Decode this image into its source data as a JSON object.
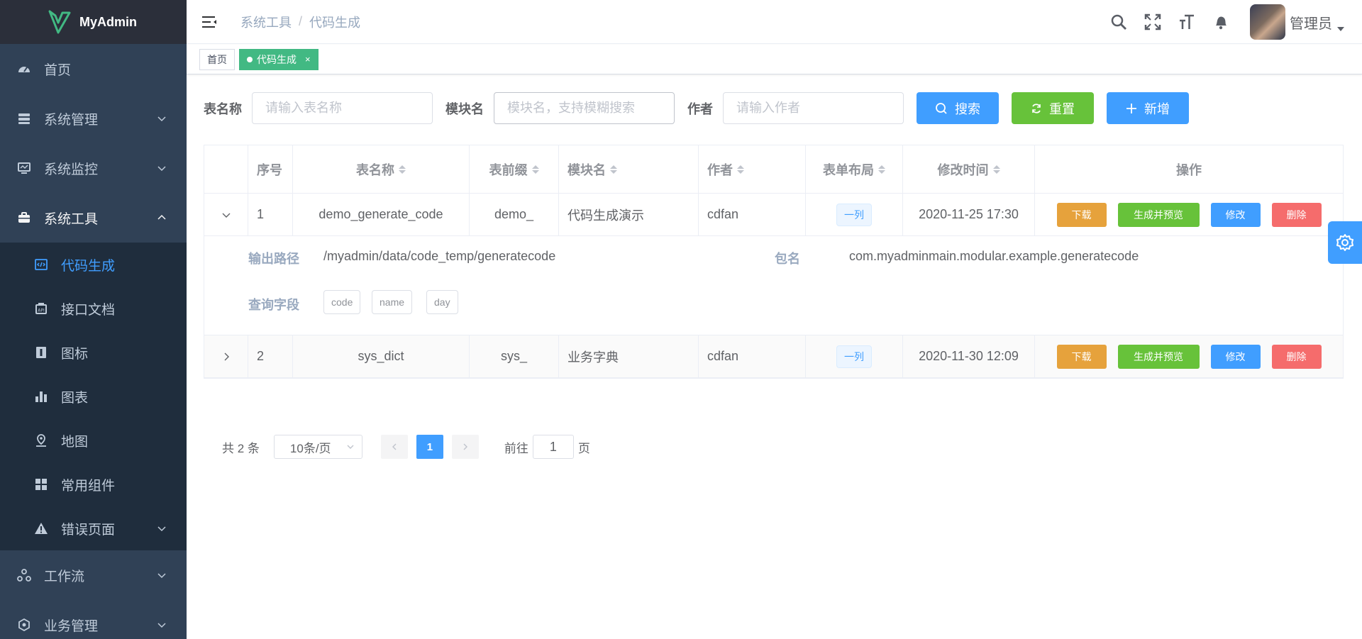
{
  "app": {
    "title": "MyAdmin"
  },
  "sidebar": {
    "items": [
      {
        "label": "首页",
        "icon": "dashboard-icon"
      },
      {
        "label": "系统管理",
        "icon": "system-icon"
      },
      {
        "label": "系统监控",
        "icon": "monitor-icon"
      },
      {
        "label": "系统工具",
        "icon": "toolbox-icon"
      },
      {
        "label": "工作流",
        "icon": "workflow-icon"
      },
      {
        "label": "业务管理",
        "icon": "business-icon"
      }
    ],
    "subitems": [
      {
        "label": "代码生成",
        "icon": "code-icon"
      },
      {
        "label": "接口文档",
        "icon": "document-icon"
      },
      {
        "label": "图标",
        "icon": "icon-icon"
      },
      {
        "label": "图表",
        "icon": "chart-icon"
      },
      {
        "label": "地图",
        "icon": "map-icon"
      },
      {
        "label": "常用组件",
        "icon": "component-icon"
      },
      {
        "label": "错误页面",
        "icon": "warning-icon"
      }
    ]
  },
  "navbar": {
    "breadcrumb": [
      "系统工具",
      "代码生成"
    ],
    "breadcrumb_sep": "/",
    "username": "管理员"
  },
  "tags": {
    "home": "首页",
    "active": "代码生成",
    "close": "×"
  },
  "search": {
    "table_label": "表名称",
    "table_placeholder": "请输入表名称",
    "module_label": "模块名",
    "module_placeholder": "模块名，支持模糊搜索",
    "author_label": "作者",
    "author_placeholder": "请输入作者",
    "search_btn": "搜索",
    "reset_btn": "重置",
    "add_btn": "新增"
  },
  "table": {
    "headers": {
      "no": "序号",
      "name": "表名称",
      "prefix": "表前缀",
      "module": "模块名",
      "author": "作者",
      "layout": "表单布局",
      "time": "修改时间",
      "op": "操作"
    },
    "rows": [
      {
        "no": "1",
        "name": "demo_generate_code",
        "prefix": "demo_",
        "module": "代码生成演示",
        "author": "cdfan",
        "layout": "一列",
        "time": "2020-11-25 17:30"
      },
      {
        "no": "2",
        "name": "sys_dict",
        "prefix": "sys_",
        "module": "业务字典",
        "author": "cdfan",
        "layout": "一列",
        "time": "2020-11-30 12:09"
      }
    ],
    "ops": {
      "download": "下载",
      "preview": "生成并预览",
      "edit": "修改",
      "delete": "删除"
    },
    "expand": {
      "path_label": "输出路径",
      "path_value": "/myadmin/data/code_temp/generatecode",
      "pkg_label": "包名",
      "pkg_value": "com.myadminmain.modular.example.generatecode",
      "fields_label": "查询字段",
      "fields": [
        "code",
        "name",
        "day"
      ]
    }
  },
  "pagination": {
    "total": "共 2 条",
    "page_size": "10条/页",
    "current": "1",
    "goto_prefix": "前往",
    "goto_value": "1",
    "goto_suffix": "页"
  },
  "colors": {
    "sidebar_bg": "#304156",
    "primary": "#409eff",
    "success": "#67c23a",
    "warning": "#e6a23c",
    "danger": "#f56c6c",
    "tag_active": "#42b983"
  }
}
